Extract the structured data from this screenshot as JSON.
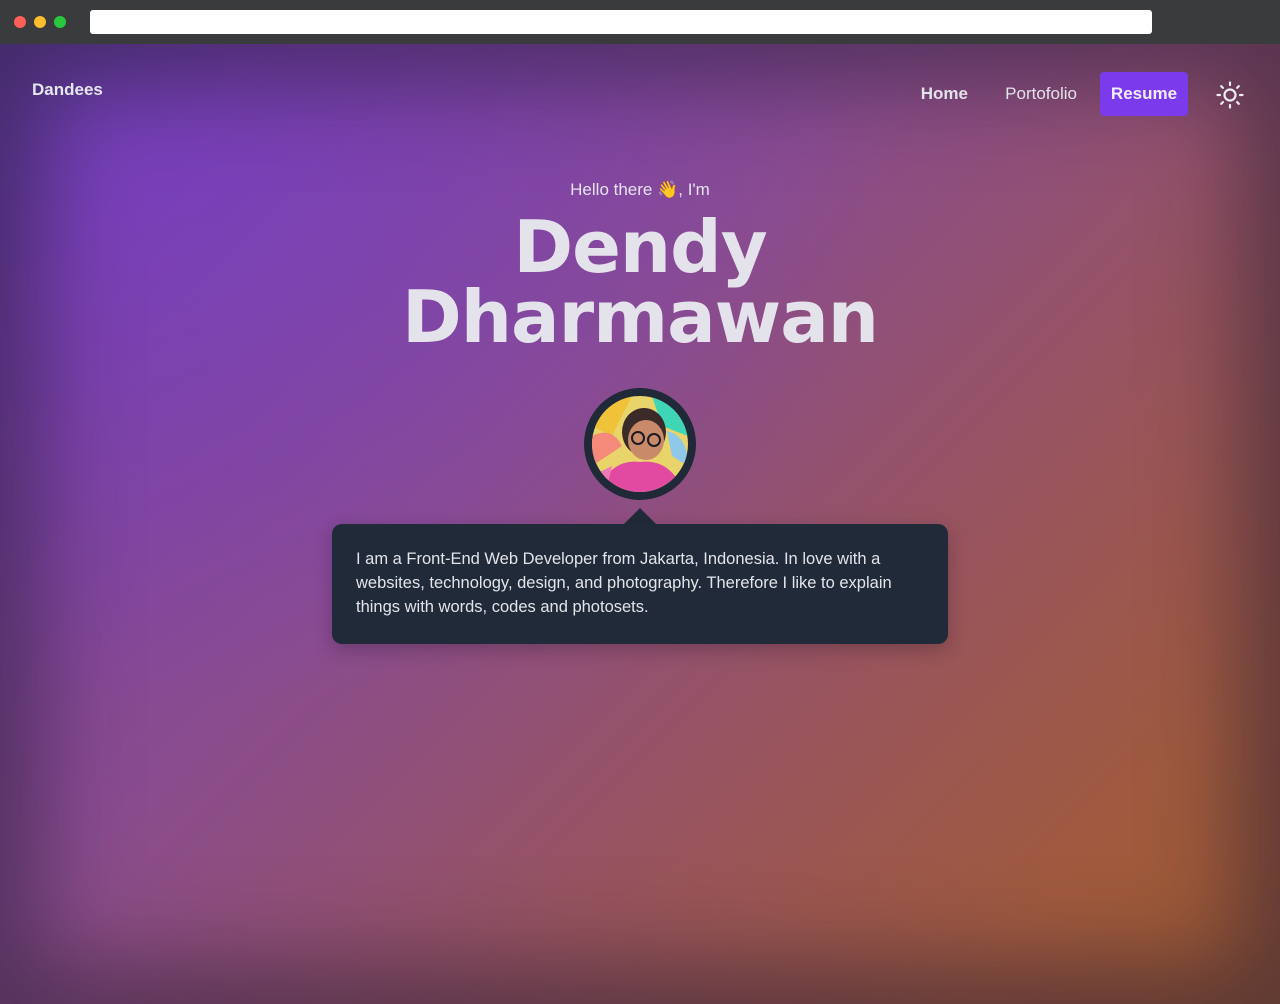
{
  "nav": {
    "brand": "Dandees",
    "home": "Home",
    "portfolio": "Portofolio",
    "resume": "Resume",
    "theme_toggle_icon": "sun-icon"
  },
  "hero": {
    "greeting": "Hello there 👋, I'm",
    "name_line1": "Dendy",
    "name_line2": "Dharmawan",
    "bio": "I am a Front-End Web Developer from Jakarta, Indonesia. In love with a websites, technology, design, and photography. Therefore I like to explain things with words, codes and photosets."
  },
  "colors": {
    "accent": "#7c3aed",
    "bubble": "#212a38",
    "avatar_ring": "#1f2937"
  }
}
